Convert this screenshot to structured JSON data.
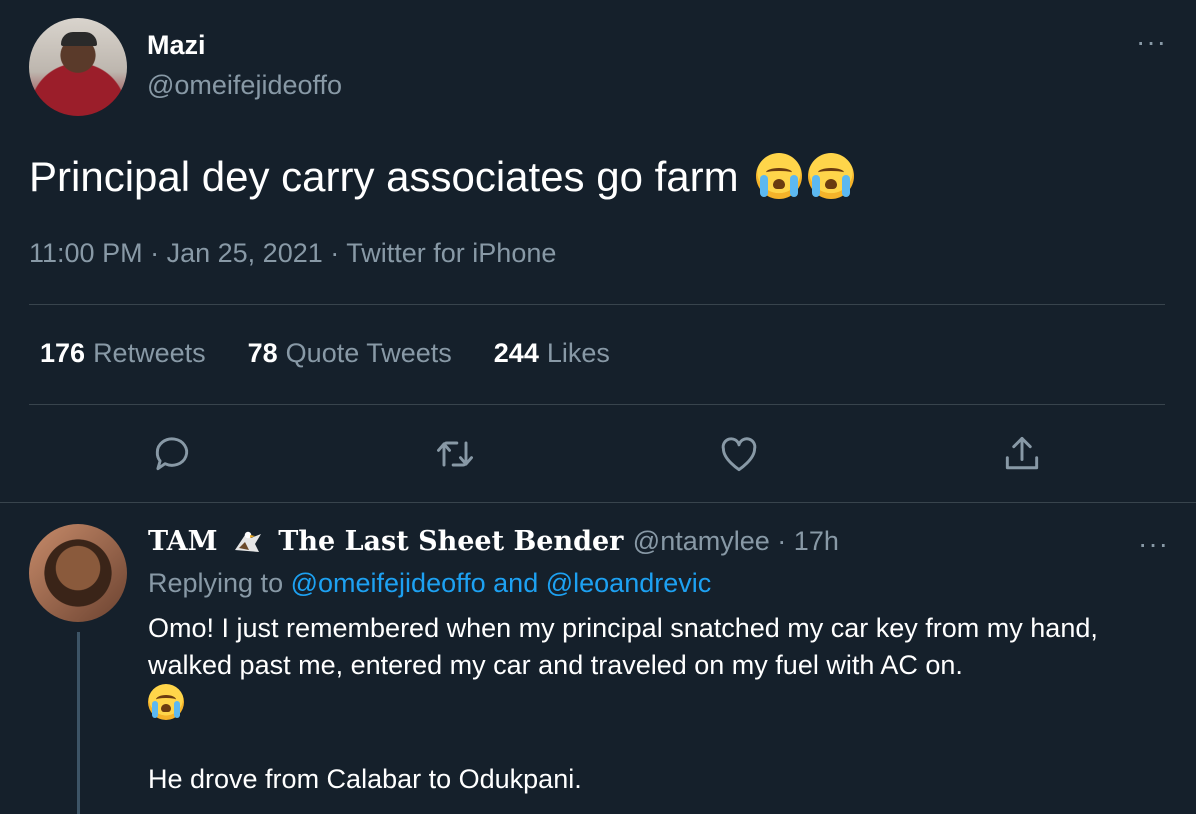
{
  "main_tweet": {
    "display_name": "Mazi",
    "handle": "@omeifejideoffo",
    "text": "Principal dey carry associates go farm",
    "emoji": [
      "loudly-crying-face",
      "loudly-crying-face"
    ],
    "time": "11:00 PM",
    "date": "Jan 25, 2021",
    "source": "Twitter for iPhone",
    "separator": "·",
    "more": "···",
    "stats": [
      {
        "value": "176",
        "label": "Retweets"
      },
      {
        "value": "78",
        "label": "Quote Tweets"
      },
      {
        "value": "244",
        "label": "Likes"
      }
    ],
    "actions": [
      "reply-icon",
      "retweet-icon",
      "like-icon",
      "share-icon"
    ]
  },
  "reply": {
    "display_name_prefix": "TAM",
    "display_name_suffix": "The Last Sheet Bender",
    "handle": "@ntamylee",
    "age": "17h",
    "separator": "·",
    "more": "···",
    "replying_prefix": "Replying to",
    "replying_user1": "@omeifejideoffo",
    "replying_and": "and",
    "replying_user2": "@leoandrevic",
    "line1": "Omo! I just remembered when my principal snatched my car key from my hand, walked past me, entered my car and traveled on my fuel with AC on.",
    "line2": "He drove from Calabar to Odukpani."
  },
  "colors": {
    "background": "#15202b",
    "secondary_text": "#8899a6",
    "link": "#1da1f2",
    "divider": "#38444d"
  }
}
